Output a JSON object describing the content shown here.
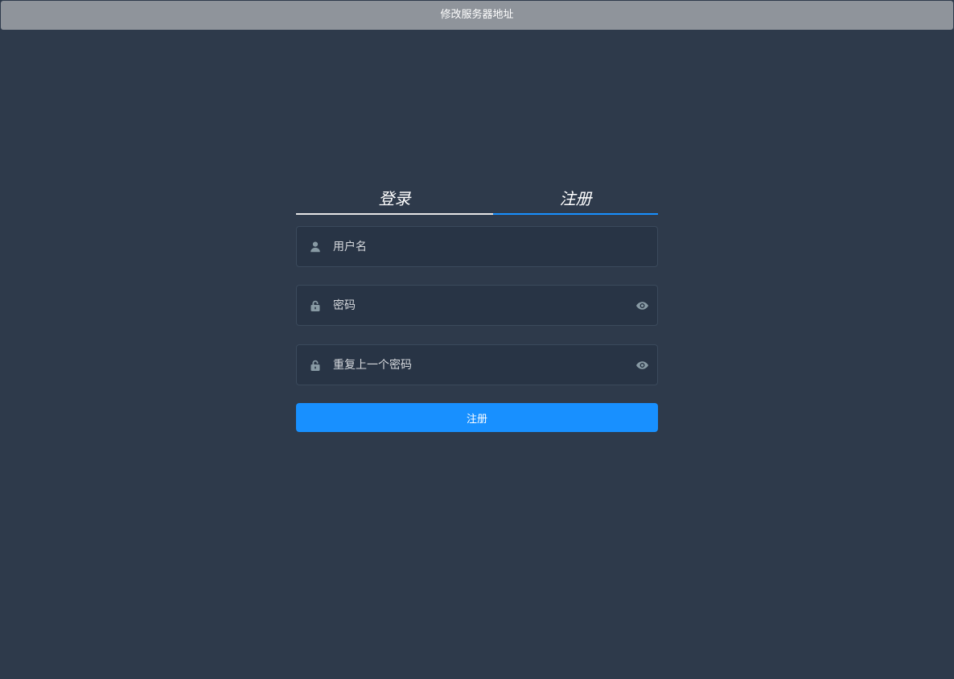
{
  "header": {
    "server_button_label": "修改服务器地址"
  },
  "tabs": {
    "login_label": "登录",
    "register_label": "注册",
    "active": "register"
  },
  "form": {
    "username": {
      "placeholder": "用户名",
      "value": ""
    },
    "password": {
      "placeholder": "密码",
      "value": ""
    },
    "repeat_password": {
      "placeholder": "重复上一个密码",
      "value": ""
    },
    "submit_label": "注册"
  },
  "icons": {
    "username": "user-icon",
    "password": "lock-icon",
    "repeat_password": "lock-icon",
    "toggle_visibility": "eye-icon"
  },
  "colors": {
    "background": "#2e3a4b",
    "accent": "#1890ff",
    "input_bg": "#283445",
    "input_border": "#3b4a5c",
    "icon": "#889aa4",
    "header_button": "#8f949b"
  }
}
